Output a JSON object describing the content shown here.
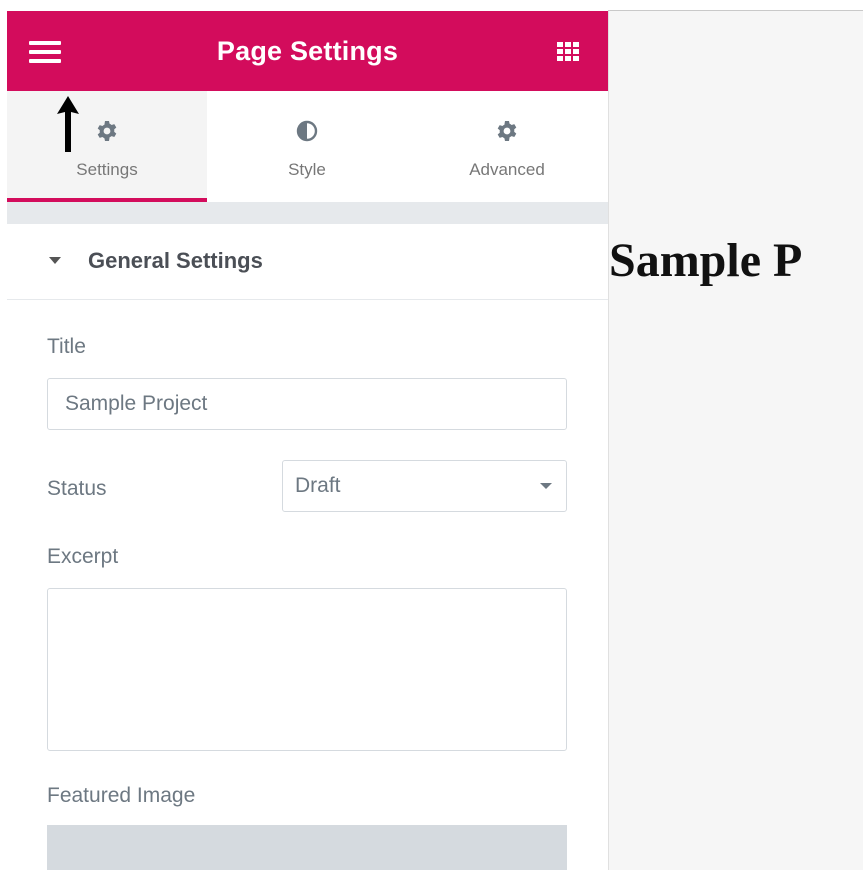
{
  "colors": {
    "header_bg": "#d30c5c",
    "tab_underline": "#d30c5c",
    "icon_gray": "#6d7882"
  },
  "header": {
    "title": "Page Settings",
    "menu_icon": "hamburger-menu-icon",
    "widgets_icon": "grid-widgets-icon"
  },
  "tabs": [
    {
      "label": "Settings",
      "icon": "gear-icon",
      "active": true
    },
    {
      "label": "Style",
      "icon": "half-circle-contrast-icon",
      "active": false
    },
    {
      "label": "Advanced",
      "icon": "gear-icon",
      "active": false
    }
  ],
  "section": {
    "title": "General Settings",
    "expanded": true
  },
  "fields": {
    "title_label": "Title",
    "title_value": "Sample Project",
    "status_label": "Status",
    "status_value": "Draft",
    "excerpt_label": "Excerpt",
    "excerpt_value": "",
    "featured_image_label": "Featured Image"
  },
  "preview": {
    "heading": "Sample P"
  }
}
